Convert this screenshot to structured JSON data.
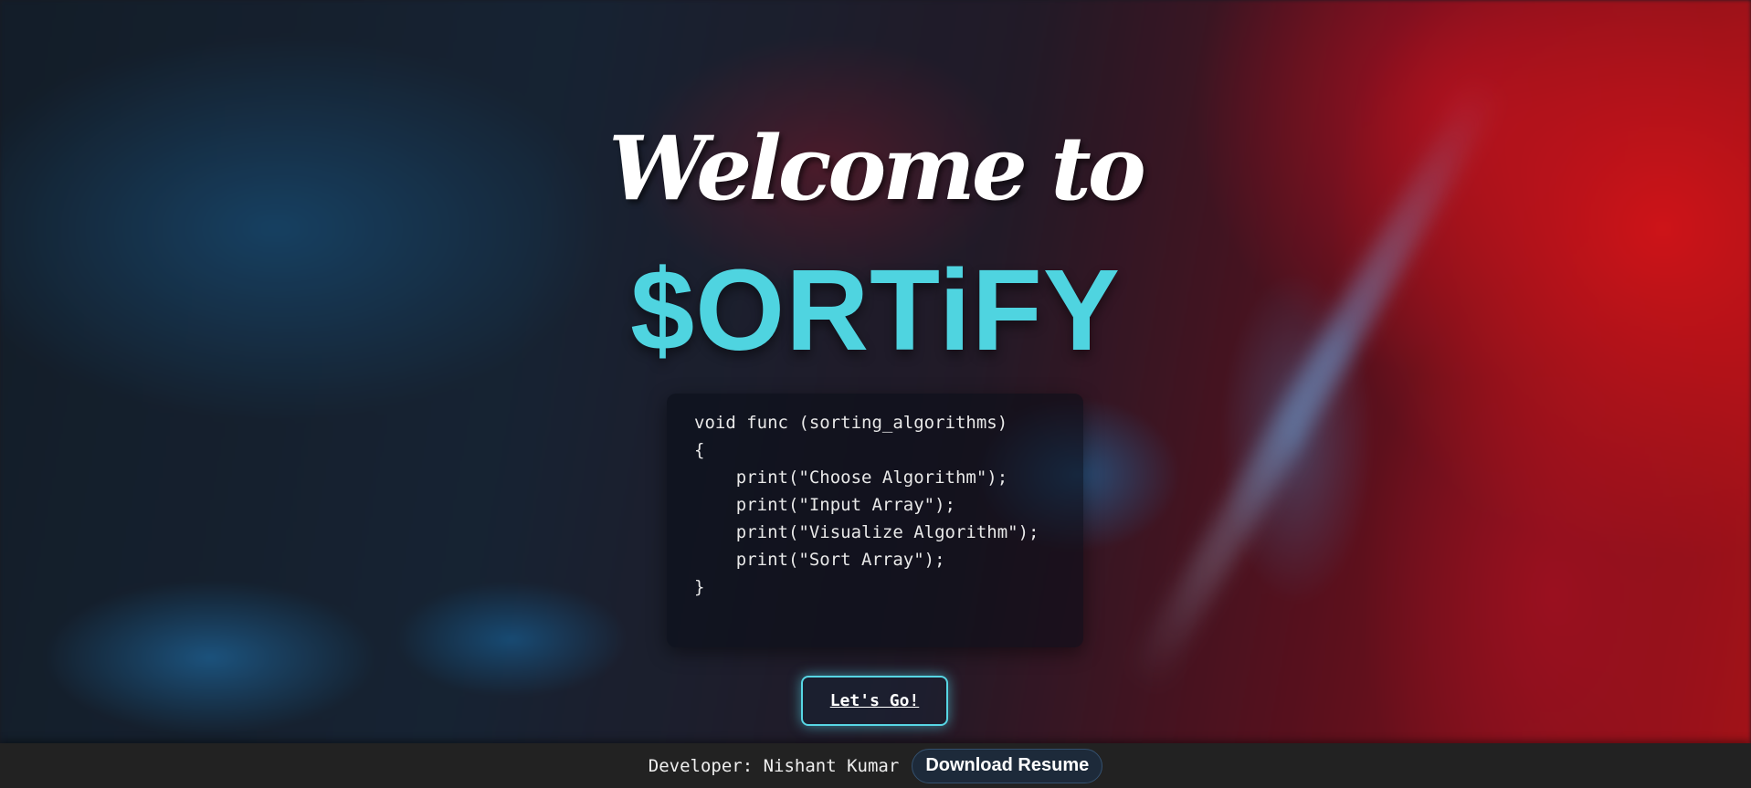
{
  "hero": {
    "welcome_text": "Welcome to",
    "brand_name": "$ORTiFY"
  },
  "code_snippet": {
    "lines": [
      "void func (sorting_algorithms)",
      "{",
      "    print(\"Choose Algorithm\");",
      "    print(\"Input Array\");",
      "    print(\"Visualize Algorithm\");",
      "    print(\"Sort Array\");",
      "}"
    ]
  },
  "cta": {
    "label": "Let's Go!"
  },
  "footer": {
    "developer_text": "Developer: Nishant Kumar",
    "resume_label": "Download Resume"
  },
  "colors": {
    "brand": "#4fd4e0",
    "footer_bg": "#222222",
    "accent_red": "#ff1a1e"
  }
}
